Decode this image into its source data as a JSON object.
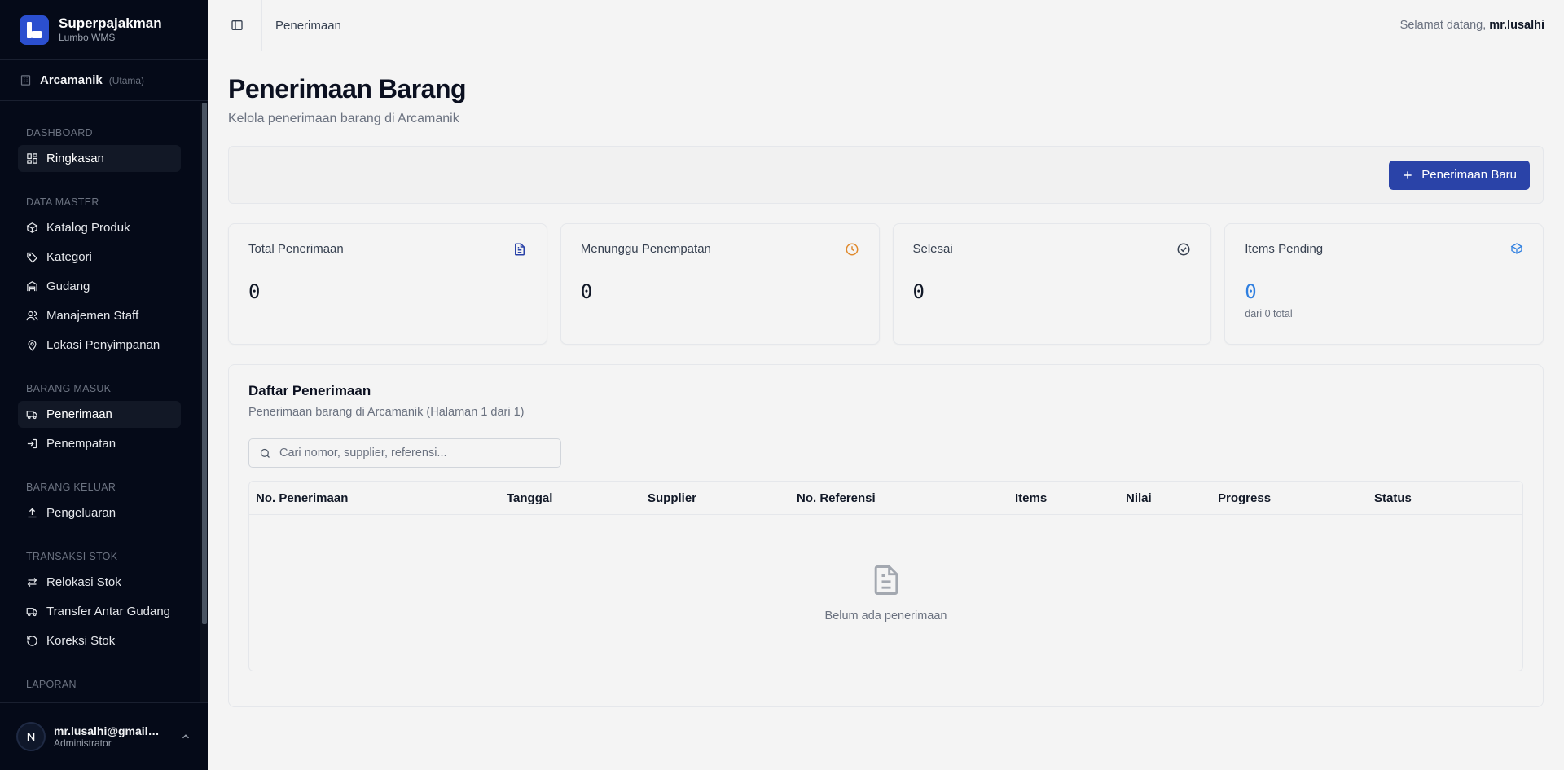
{
  "sidebar": {
    "brand_name": "Superpajakman",
    "brand_sub": "Lumbo WMS",
    "location_name": "Arcamanik",
    "location_tag": "(Utama)",
    "sections": [
      {
        "title": "DASHBOARD",
        "items": [
          {
            "label": "Ringkasan",
            "icon": "grid-icon",
            "active": true
          }
        ]
      },
      {
        "title": "DATA MASTER",
        "items": [
          {
            "label": "Katalog Produk",
            "icon": "box-icon"
          },
          {
            "label": "Kategori",
            "icon": "tags-icon"
          },
          {
            "label": "Gudang",
            "icon": "warehouse-icon"
          },
          {
            "label": "Manajemen Staff",
            "icon": "users-icon"
          },
          {
            "label": "Lokasi Penyimpanan",
            "icon": "map-pin-icon"
          }
        ]
      },
      {
        "title": "BARANG MASUK",
        "items": [
          {
            "label": "Penerimaan",
            "icon": "truck-icon",
            "active": true
          },
          {
            "label": "Penempatan",
            "icon": "sign-in-icon"
          }
        ]
      },
      {
        "title": "BARANG KELUAR",
        "items": [
          {
            "label": "Pengeluaran",
            "icon": "upload-icon"
          }
        ]
      },
      {
        "title": "TRANSAKSI STOK",
        "items": [
          {
            "label": "Relokasi Stok",
            "icon": "arrows-left-right-icon"
          },
          {
            "label": "Transfer Antar Gudang",
            "icon": "truck-icon"
          },
          {
            "label": "Koreksi Stok",
            "icon": "rotate-ccw-icon"
          }
        ]
      },
      {
        "title": "LAPORAN",
        "items": []
      }
    ],
    "user": {
      "initial": "N",
      "email": "mr.lusalhi@gmail.com",
      "role": "Administrator"
    }
  },
  "topbar": {
    "breadcrumb": "Penerimaan",
    "welcome_prefix": "Selamat datang, ",
    "welcome_user": "mr.lusalhi"
  },
  "page": {
    "title": "Penerimaan Barang",
    "subtitle": "Kelola penerimaan barang di Arcamanik",
    "new_button": "Penerimaan Baru"
  },
  "stats": [
    {
      "label": "Total Penerimaan",
      "value": "0",
      "icon": "file-text-icon",
      "color": "#2a43a8"
    },
    {
      "label": "Menunggu Penempatan",
      "value": "0",
      "icon": "clock-icon",
      "color": "#e08a2e"
    },
    {
      "label": "Selesai",
      "value": "0",
      "icon": "check-circle-icon",
      "color": "#374151"
    },
    {
      "label": "Items Pending",
      "value": "0",
      "foot": "dari 0 total",
      "icon": "package-icon",
      "color": "#2f7fe0"
    }
  ],
  "list": {
    "title": "Daftar Penerimaan",
    "subtitle": "Penerimaan barang di Arcamanik (Halaman 1 dari 1)",
    "search_placeholder": "Cari nomor, supplier, referensi...",
    "columns": [
      "No. Penerimaan",
      "Tanggal",
      "Supplier",
      "No. Referensi",
      "Items",
      "Nilai",
      "Progress",
      "Status"
    ],
    "empty_text": "Belum ada penerimaan"
  },
  "colors": {
    "accent": "#2a43a8",
    "sidebar_bg": "#050a18",
    "frame": "#1e40d8"
  }
}
